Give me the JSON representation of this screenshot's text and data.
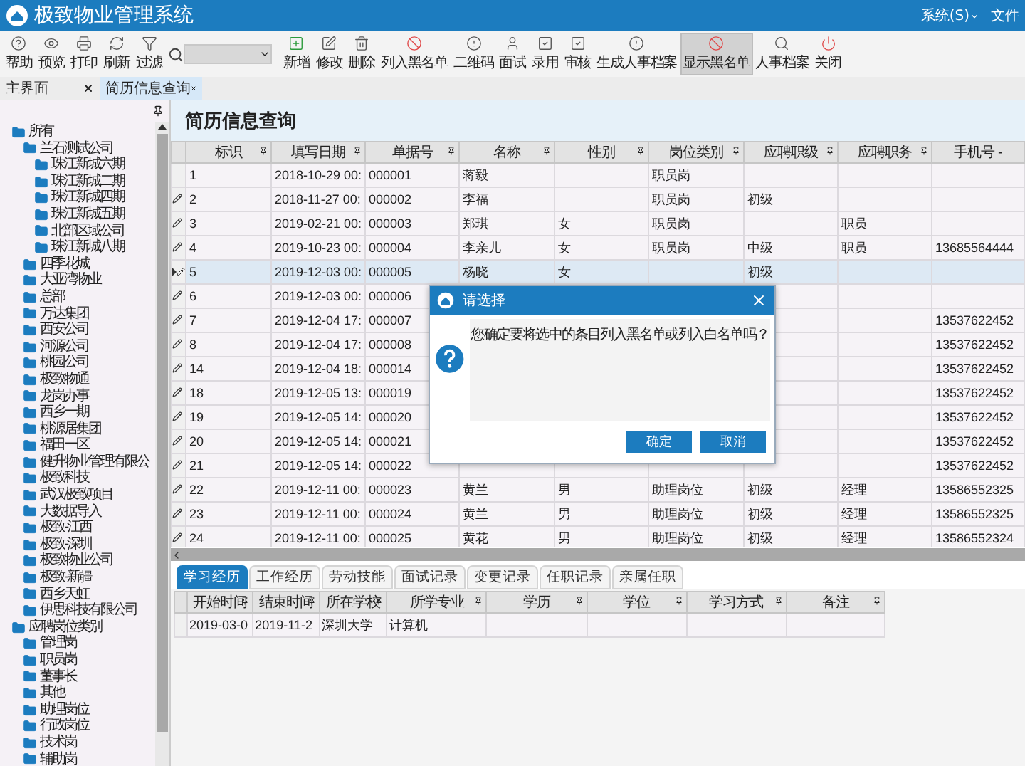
{
  "window": {
    "title": "极致物业管理系统",
    "menus": [
      "系统(S)",
      "文件"
    ]
  },
  "toolbar": {
    "left": [
      {
        "label": "帮助",
        "kind": "help",
        "selected": false
      },
      {
        "label": "预览",
        "kind": "preview",
        "selected": false
      },
      {
        "label": "打印",
        "kind": "print",
        "selected": false
      },
      {
        "label": "刷新",
        "kind": "refresh",
        "selected": false
      },
      {
        "label": "过滤",
        "kind": "filter",
        "selected": false
      }
    ],
    "right": [
      {
        "label": "新增",
        "kind": "add",
        "selected": false
      },
      {
        "label": "修改",
        "kind": "edit",
        "selected": false
      },
      {
        "label": "删除",
        "kind": "delete",
        "selected": false
      },
      {
        "label": "列入黑名单",
        "kind": "ban",
        "selected": false
      },
      {
        "label": "二维码",
        "kind": "info",
        "selected": false
      },
      {
        "label": "面试",
        "kind": "person",
        "selected": false
      },
      {
        "label": "录用",
        "kind": "check",
        "selected": false
      },
      {
        "label": "审核",
        "kind": "check",
        "selected": false
      },
      {
        "label": "生成人事档案",
        "kind": "info",
        "selected": false
      },
      {
        "label": "显示黑名单",
        "kind": "ban",
        "selected": true
      },
      {
        "label": "人事档案",
        "kind": "find",
        "selected": false
      },
      {
        "label": "关闭",
        "kind": "power",
        "selected": false
      }
    ]
  },
  "tabs": [
    {
      "label": "主界面",
      "selected": false
    },
    {
      "label": "简历信息查询",
      "selected": true
    }
  ],
  "page_title": "简历信息查询",
  "tree": [
    {
      "label": "所有",
      "children": [
        {
          "label": "兰石测试公司",
          "children": [
            {
              "label": "珠江新城六期"
            },
            {
              "label": "珠江新城二期"
            },
            {
              "label": "珠江新城四期"
            },
            {
              "label": "珠江新城五期"
            },
            {
              "label": "北部区域公司"
            },
            {
              "label": "珠江新城八期"
            }
          ]
        },
        {
          "label": "四季花城"
        },
        {
          "label": "大亚湾物业"
        },
        {
          "label": "总部"
        },
        {
          "label": "万达集团"
        },
        {
          "label": "西安公司"
        },
        {
          "label": "河源公司"
        },
        {
          "label": "桃园公司"
        },
        {
          "label": "极致物通"
        },
        {
          "label": "龙岗办事"
        },
        {
          "label": "西乡一期"
        },
        {
          "label": "桃源居集团"
        },
        {
          "label": "福田一区"
        },
        {
          "label": "健升物业管理有限公"
        },
        {
          "label": "极致科技"
        },
        {
          "label": "武汉极致项目"
        },
        {
          "label": "大数据导入"
        },
        {
          "label": "极致-江西"
        },
        {
          "label": "极致-深圳"
        },
        {
          "label": "极致物业公司"
        },
        {
          "label": "极致-新疆"
        },
        {
          "label": "西乡天虹"
        },
        {
          "label": "伊思科技有限公司"
        }
      ]
    },
    {
      "label": "应聘岗位类别",
      "children": [
        {
          "label": "管理岗"
        },
        {
          "label": "职员岗"
        },
        {
          "label": "董事长"
        },
        {
          "label": "其他"
        },
        {
          "label": "助理岗位"
        },
        {
          "label": "行政岗位"
        },
        {
          "label": "技术岗"
        },
        {
          "label": "辅助岗"
        }
      ]
    }
  ],
  "table": {
    "columns": [
      "标识",
      "填写日期",
      "单据号",
      "名称",
      "性别",
      "岗位类别",
      "应聘职级",
      "应聘职务",
      "手机号 -"
    ],
    "rows": [
      {
        "editing": false,
        "current": false,
        "selected": false,
        "cells": [
          "1",
          "2018-10-29 00:",
          "000001",
          "蒋毅",
          null,
          "职员岗",
          null,
          null,
          null
        ]
      },
      {
        "editing": true,
        "current": false,
        "selected": false,
        "cells": [
          "2",
          "2018-11-27 00:",
          "000002",
          "李福",
          null,
          "职员岗",
          "初级",
          null,
          null
        ]
      },
      {
        "editing": true,
        "current": false,
        "selected": false,
        "cells": [
          "3",
          "2019-02-21 00:",
          "000003",
          "郑琪",
          "女",
          "职员岗",
          null,
          "职员",
          null
        ]
      },
      {
        "editing": true,
        "current": false,
        "selected": false,
        "cells": [
          "4",
          "2019-10-23 00:",
          "000004",
          "李亲儿",
          "女",
          "职员岗",
          "中级",
          "职员",
          "13685564444"
        ]
      },
      {
        "editing": true,
        "current": true,
        "selected": true,
        "cells": [
          "5",
          "2019-12-03 00:",
          "000005",
          "杨晓",
          "女",
          null,
          "初级",
          null,
          null
        ]
      },
      {
        "editing": true,
        "current": false,
        "selected": false,
        "cells": [
          "6",
          "2019-12-03 00:",
          "000006",
          null,
          null,
          null,
          null,
          null,
          null
        ]
      },
      {
        "editing": true,
        "current": false,
        "selected": false,
        "cells": [
          "7",
          "2019-12-04 17:",
          "000007",
          null,
          null,
          null,
          null,
          null,
          "13537622452"
        ]
      },
      {
        "editing": true,
        "current": false,
        "selected": false,
        "cells": [
          "8",
          "2019-12-04 17:",
          "000008",
          null,
          null,
          null,
          null,
          null,
          "13537622452"
        ]
      },
      {
        "editing": true,
        "current": false,
        "selected": false,
        "cells": [
          "14",
          "2019-12-04 18:",
          "000014",
          null,
          null,
          null,
          null,
          null,
          "13537622452"
        ]
      },
      {
        "editing": true,
        "current": false,
        "selected": false,
        "cells": [
          "18",
          "2019-12-05 13:",
          "000019",
          null,
          null,
          null,
          null,
          null,
          "13537622452"
        ]
      },
      {
        "editing": true,
        "current": false,
        "selected": false,
        "cells": [
          "19",
          "2019-12-05 14:",
          "000020",
          null,
          null,
          null,
          null,
          null,
          "13537622452"
        ]
      },
      {
        "editing": true,
        "current": false,
        "selected": false,
        "cells": [
          "20",
          "2019-12-05 14:",
          "000021",
          null,
          null,
          null,
          null,
          null,
          "13537622452"
        ]
      },
      {
        "editing": true,
        "current": false,
        "selected": false,
        "cells": [
          "21",
          "2019-12-05 14:",
          "000022",
          null,
          null,
          null,
          null,
          null,
          "13537622452"
        ]
      },
      {
        "editing": true,
        "current": false,
        "selected": false,
        "cells": [
          "22",
          "2019-12-11 00:",
          "000023",
          "黄兰",
          "男",
          "助理岗位",
          "初级",
          "经理",
          "13586552325"
        ]
      },
      {
        "editing": true,
        "current": false,
        "selected": false,
        "cells": [
          "23",
          "2019-12-11 00:",
          "000024",
          "黄兰",
          "男",
          "助理岗位",
          "初级",
          "经理",
          "13586552325"
        ]
      },
      {
        "editing": true,
        "current": false,
        "selected": false,
        "cells": [
          "24",
          "2019-12-11 00:",
          "000025",
          "黄花",
          "男",
          "助理岗位",
          "初级",
          "经理",
          "13586552324"
        ]
      }
    ]
  },
  "detail_tabs": [
    {
      "label": "学习经历",
      "selected": true
    },
    {
      "label": "工作经历",
      "selected": false
    },
    {
      "label": "劳动技能",
      "selected": false
    },
    {
      "label": "面试记录",
      "selected": false
    },
    {
      "label": "变更记录",
      "selected": false
    },
    {
      "label": "任职记录",
      "selected": false
    },
    {
      "label": "亲属任职",
      "selected": false
    }
  ],
  "detail_table": {
    "columns": [
      "开始时间",
      "结束时间",
      "所在学校",
      "所学专业",
      "学历",
      "学位",
      "学习方式",
      "备注"
    ],
    "rows": [
      {
        "cells": [
          "2019-03-0",
          "2019-11-2",
          "深圳大学",
          "计算机",
          null,
          null,
          null,
          null
        ]
      }
    ]
  },
  "dialog": {
    "title": "请选择",
    "message": "您确定要将选中的条目列入黑名单或列入白名单吗？",
    "buttons": [
      "确定",
      "取消"
    ]
  }
}
